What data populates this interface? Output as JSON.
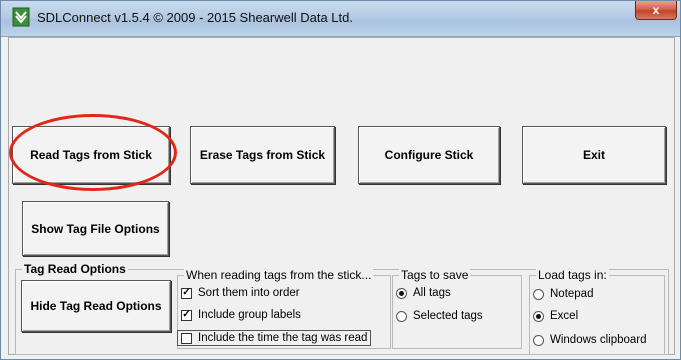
{
  "window": {
    "title": "SDLConnect v1.5.4 © 2009 - 2015 Shearwell Data Ltd.",
    "close_label": "x"
  },
  "buttons": {
    "read_tags": "Read Tags from Stick",
    "erase_tags": "Erase Tags from Stick",
    "configure_stick": "Configure Stick",
    "exit": "Exit",
    "show_tag_file_options": "Show Tag File Options",
    "hide_tag_read_options": "Hide Tag Read Options"
  },
  "tag_read_options": {
    "label": "Tag Read Options",
    "reading": {
      "label": "When reading tags from the stick...",
      "options": [
        {
          "label": "Sort them into order",
          "checked": true
        },
        {
          "label": "Include group labels",
          "checked": true
        },
        {
          "label": "Include the time the tag was read",
          "checked": false
        }
      ]
    },
    "tags_to_save": {
      "label": "Tags to save",
      "options": [
        {
          "label": "All tags",
          "selected": true
        },
        {
          "label": "Selected tags",
          "selected": false
        }
      ]
    },
    "load_tags_in": {
      "label": "Load tags in:",
      "options": [
        {
          "label": "Notepad",
          "selected": false
        },
        {
          "label": "Excel",
          "selected": true
        },
        {
          "label": "Windows clipboard",
          "selected": false
        }
      ]
    }
  },
  "colors": {
    "highlight": "#e3261a",
    "close_button": "#c3442a",
    "titlebar": "#b4cbe4"
  },
  "icons": {
    "app": "tag-reader-icon",
    "check": "check-mark",
    "radio": "radio-dot"
  }
}
